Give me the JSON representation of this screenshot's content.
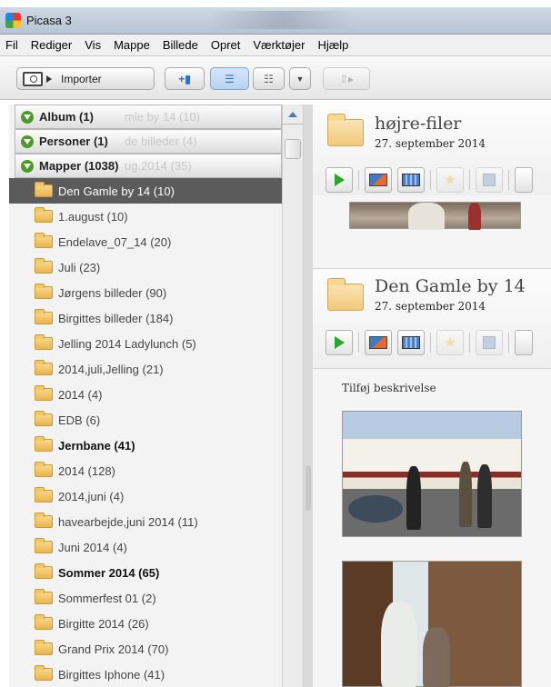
{
  "window": {
    "title": "Picasa 3"
  },
  "menubar": {
    "items": [
      "Fil",
      "Rediger",
      "Vis",
      "Mappe",
      "Billede",
      "Opret",
      "Værktøjer",
      "Hjælp"
    ]
  },
  "toolbar": {
    "import_label": "Importer"
  },
  "sidebar": {
    "groups": [
      {
        "label": "Album (1)",
        "ghost": "mle by 14 (10)"
      },
      {
        "label": "Personer (1)",
        "ghost": "de billeder (4)"
      },
      {
        "label": "Mapper (1038)",
        "ghost": "ug.2014 (35)"
      }
    ],
    "folders": [
      {
        "label": "Den Gamle by 14 (10)",
        "selected": true,
        "bold": false
      },
      {
        "label": "1.august (10)",
        "selected": false,
        "bold": false
      },
      {
        "label": "Endelave_07_14 (20)",
        "selected": false,
        "bold": false
      },
      {
        "label": "Juli (23)",
        "selected": false,
        "bold": false
      },
      {
        "label": "Jørgens billeder (90)",
        "selected": false,
        "bold": false
      },
      {
        "label": "Birgittes billeder (184)",
        "selected": false,
        "bold": false
      },
      {
        "label": "Jelling 2014 Ladylunch (5)",
        "selected": false,
        "bold": false
      },
      {
        "label": "2014,juli,Jelling (21)",
        "selected": false,
        "bold": false
      },
      {
        "label": "2014 (4)",
        "selected": false,
        "bold": false
      },
      {
        "label": "EDB (6)",
        "selected": false,
        "bold": false
      },
      {
        "label": "Jernbane (41)",
        "selected": false,
        "bold": true
      },
      {
        "label": "2014 (128)",
        "selected": false,
        "bold": false
      },
      {
        "label": "2014,juni (4)",
        "selected": false,
        "bold": false
      },
      {
        "label": "havearbejde,juni 2014 (11)",
        "selected": false,
        "bold": false
      },
      {
        "label": "Juni 2014 (4)",
        "selected": false,
        "bold": false
      },
      {
        "label": "Sommer 2014 (65)",
        "selected": false,
        "bold": true
      },
      {
        "label": "Sommerfest 01 (2)",
        "selected": false,
        "bold": false
      },
      {
        "label": "Birgitte 2014 (26)",
        "selected": false,
        "bold": false
      },
      {
        "label": "Grand Prix 2014 (70)",
        "selected": false,
        "bold": false
      },
      {
        "label": "Birgittes Iphone (41)",
        "selected": false,
        "bold": false
      }
    ]
  },
  "main": {
    "folder1": {
      "title": "højre-filer",
      "date": "27. september 2014"
    },
    "folder2": {
      "title": "Den Gamle by 14",
      "date": "27. september 2014",
      "description_placeholder": "Tilføj beskrivelse"
    }
  }
}
